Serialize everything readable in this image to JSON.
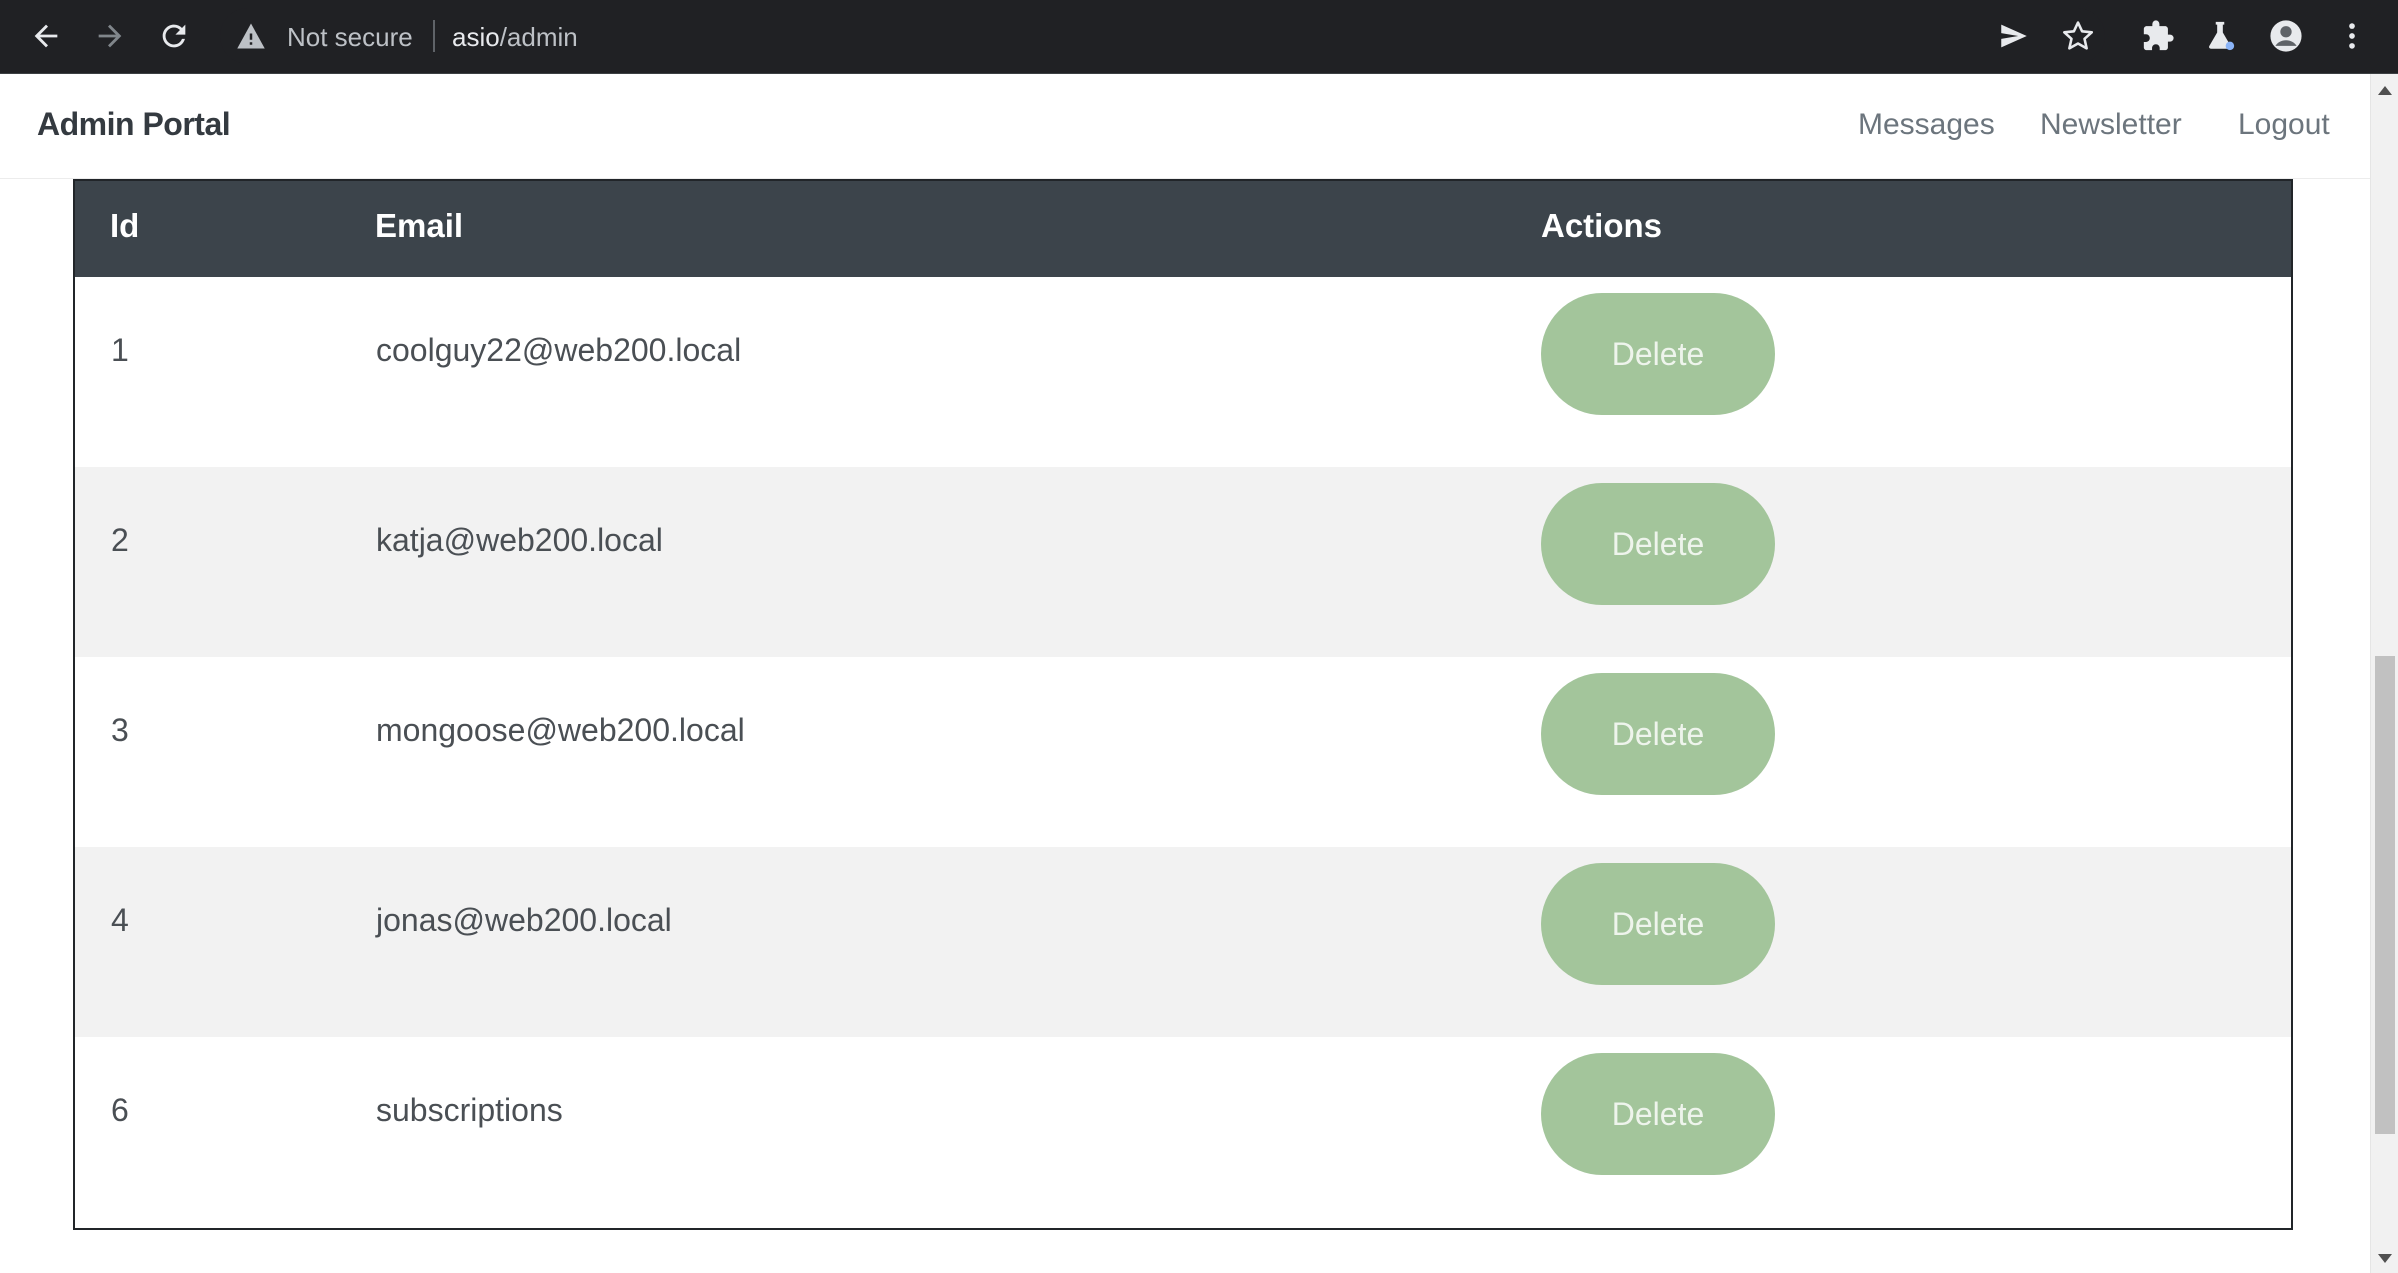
{
  "browser": {
    "security_label": "Not secure",
    "url_host": "asio",
    "url_path": "/admin"
  },
  "header": {
    "brand": "Admin Portal",
    "nav": [
      "Messages",
      "Newsletter",
      "Logout"
    ]
  },
  "table": {
    "columns": [
      "Id",
      "Email",
      "Actions"
    ],
    "rows": [
      {
        "id": "1",
        "email": "coolguy22@web200.local",
        "action": "Delete"
      },
      {
        "id": "2",
        "email": "katja@web200.local",
        "action": "Delete"
      },
      {
        "id": "3",
        "email": "mongoose@web200.local",
        "action": "Delete"
      },
      {
        "id": "4",
        "email": "jonas@web200.local",
        "action": "Delete"
      },
      {
        "id": "6",
        "email": "subscriptions",
        "action": "Delete"
      }
    ]
  },
  "colors": {
    "chrome_bg": "#202124",
    "table_header_bg": "#3c444b",
    "delete_button_bg": "#a3c59b",
    "row_alt_bg": "#f2f2f2"
  },
  "icons": [
    "back-icon",
    "forward-icon",
    "reload-icon",
    "warning-icon",
    "send-icon",
    "star-icon",
    "extensions-icon",
    "labs-icon",
    "profile-icon",
    "menu-icon"
  ]
}
